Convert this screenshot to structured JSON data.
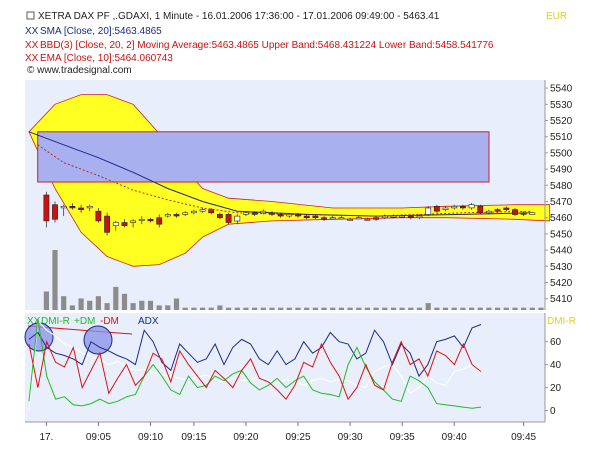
{
  "header": {
    "line1": "XETRA DAX PF      ,.GDAXI, 1 Minute - 16.01.2006 17:36:00 - 17.01.2006 09:49:00 - 5463.41",
    "line2": "SMA [Close, 20]:5463.4865",
    "line3": "BBD(3) [Close, 20, 2] Moving Average:5463.4865 Upper Band:5468.431224 Lower Band:5458.541776",
    "line4": "EMA [Close, 10]:5464.060743",
    "watermark": "© www.tradesignal.com",
    "currency": "EUR",
    "lower_title_dmi": "DMI-R",
    "lower_title_plusdm": "+DM",
    "lower_title_minusdm": "-DM",
    "lower_title_adx": "ADX",
    "lower_right_label": "DMI-R"
  },
  "colors": {
    "panel_bg": "#e8eefc",
    "sma": "#1a2a8a",
    "ema": "#b81818",
    "band_fill": "#ffff22",
    "band_stroke": "#cc2222",
    "box_fill": "#a8b0f0",
    "box_stroke": "#cc2222",
    "up_candle": "#ffffff",
    "down_candle": "#cc1111",
    "volume": "#8c8c8c",
    "dmi_green": "#22bb22",
    "dmi_red": "#dd1111",
    "adx_blue": "#1a2a8a",
    "dmi_white": "#ffffff"
  },
  "chart_data": [
    {
      "type": "candlestick",
      "title": "XETRA DAX PF ,.GDAXI, 1 Minute",
      "ylim": [
        5403,
        5545
      ],
      "y_ticks": [
        5410,
        5420,
        5430,
        5440,
        5450,
        5460,
        5470,
        5480,
        5490,
        5500,
        5510,
        5520,
        5530,
        5540
      ],
      "x_ticks": [
        "17.",
        "09:05",
        "09:10",
        "09:15",
        "09:20",
        "09:25",
        "09:30",
        "09:35",
        "09:40",
        "09:45"
      ],
      "x_tick_index": [
        2,
        8,
        14,
        19,
        25,
        31,
        37,
        43,
        49,
        57
      ],
      "n_bars": 60,
      "candles": [
        {
          "i": 2,
          "o": 5474,
          "h": 5476,
          "l": 5454,
          "c": 5458
        },
        {
          "i": 3,
          "o": 5468,
          "h": 5470,
          "l": 5457,
          "c": 5459
        },
        {
          "i": 4,
          "o": 5466,
          "h": 5468,
          "l": 5461,
          "c": 5467
        },
        {
          "i": 5,
          "o": 5467,
          "h": 5469,
          "l": 5465,
          "c": 5466
        },
        {
          "i": 6,
          "o": 5466,
          "h": 5468,
          "l": 5463,
          "c": 5465
        },
        {
          "i": 7,
          "o": 5466,
          "h": 5468,
          "l": 5464,
          "c": 5467
        },
        {
          "i": 8,
          "o": 5464,
          "h": 5466,
          "l": 5457,
          "c": 5458
        },
        {
          "i": 9,
          "o": 5461,
          "h": 5463,
          "l": 5449,
          "c": 5451
        },
        {
          "i": 10,
          "o": 5455,
          "h": 5458,
          "l": 5452,
          "c": 5457
        },
        {
          "i": 11,
          "o": 5457,
          "h": 5459,
          "l": 5454,
          "c": 5455
        },
        {
          "i": 12,
          "o": 5457,
          "h": 5459,
          "l": 5454,
          "c": 5458
        },
        {
          "i": 13,
          "o": 5459,
          "h": 5461,
          "l": 5456,
          "c": 5459
        },
        {
          "i": 14,
          "o": 5459,
          "h": 5460,
          "l": 5457,
          "c": 5458
        },
        {
          "i": 15,
          "o": 5460,
          "h": 5462,
          "l": 5454,
          "c": 5456
        },
        {
          "i": 16,
          "o": 5461,
          "h": 5463,
          "l": 5460,
          "c": 5462
        },
        {
          "i": 17,
          "o": 5462,
          "h": 5463,
          "l": 5460,
          "c": 5461
        },
        {
          "i": 18,
          "o": 5462,
          "h": 5464,
          "l": 5461,
          "c": 5463
        },
        {
          "i": 19,
          "o": 5463,
          "h": 5465,
          "l": 5462,
          "c": 5464
        },
        {
          "i": 20,
          "o": 5464,
          "h": 5466,
          "l": 5463,
          "c": 5465
        },
        {
          "i": 21,
          "o": 5465,
          "h": 5466,
          "l": 5462,
          "c": 5463
        },
        {
          "i": 22,
          "o": 5462,
          "h": 5463,
          "l": 5459,
          "c": 5460
        },
        {
          "i": 23,
          "o": 5462,
          "h": 5463,
          "l": 5456,
          "c": 5457
        },
        {
          "i": 24,
          "o": 5458,
          "h": 5462,
          "l": 5456,
          "c": 5461
        },
        {
          "i": 25,
          "o": 5462,
          "h": 5464,
          "l": 5461,
          "c": 5463
        },
        {
          "i": 26,
          "o": 5463,
          "h": 5464,
          "l": 5461,
          "c": 5462
        },
        {
          "i": 27,
          "o": 5463,
          "h": 5465,
          "l": 5462,
          "c": 5464
        },
        {
          "i": 28,
          "o": 5463,
          "h": 5464,
          "l": 5461,
          "c": 5462
        },
        {
          "i": 29,
          "o": 5462,
          "h": 5463,
          "l": 5460,
          "c": 5461
        },
        {
          "i": 30,
          "o": 5461,
          "h": 5463,
          "l": 5460,
          "c": 5462
        },
        {
          "i": 31,
          "o": 5462,
          "h": 5463,
          "l": 5460,
          "c": 5461
        },
        {
          "i": 32,
          "o": 5461,
          "h": 5462,
          "l": 5459,
          "c": 5460
        },
        {
          "i": 33,
          "o": 5461,
          "h": 5462,
          "l": 5459,
          "c": 5460
        },
        {
          "i": 34,
          "o": 5460,
          "h": 5461,
          "l": 5458,
          "c": 5459
        },
        {
          "i": 35,
          "o": 5460,
          "h": 5461,
          "l": 5459,
          "c": 5460
        },
        {
          "i": 36,
          "o": 5460,
          "h": 5461,
          "l": 5459,
          "c": 5460
        },
        {
          "i": 37,
          "o": 5459,
          "h": 5460,
          "l": 5458,
          "c": 5459
        },
        {
          "i": 38,
          "o": 5460,
          "h": 5461,
          "l": 5459,
          "c": 5460
        },
        {
          "i": 39,
          "o": 5459,
          "h": 5460,
          "l": 5458,
          "c": 5459
        },
        {
          "i": 40,
          "o": 5460,
          "h": 5461,
          "l": 5458,
          "c": 5459
        },
        {
          "i": 41,
          "o": 5460,
          "h": 5462,
          "l": 5459,
          "c": 5461
        },
        {
          "i": 42,
          "o": 5461,
          "h": 5462,
          "l": 5460,
          "c": 5461
        },
        {
          "i": 43,
          "o": 5461,
          "h": 5462,
          "l": 5460,
          "c": 5461
        },
        {
          "i": 44,
          "o": 5461,
          "h": 5462,
          "l": 5459,
          "c": 5460
        },
        {
          "i": 45,
          "o": 5460,
          "h": 5462,
          "l": 5459,
          "c": 5461
        },
        {
          "i": 46,
          "o": 5462,
          "h": 5467,
          "l": 5461,
          "c": 5466
        },
        {
          "i": 47,
          "o": 5467,
          "h": 5468,
          "l": 5463,
          "c": 5464
        },
        {
          "i": 48,
          "o": 5465,
          "h": 5467,
          "l": 5464,
          "c": 5466
        },
        {
          "i": 49,
          "o": 5466,
          "h": 5468,
          "l": 5465,
          "c": 5467
        },
        {
          "i": 50,
          "o": 5467,
          "h": 5468,
          "l": 5465,
          "c": 5466
        },
        {
          "i": 51,
          "o": 5466,
          "h": 5469,
          "l": 5465,
          "c": 5468
        },
        {
          "i": 52,
          "o": 5467,
          "h": 5468,
          "l": 5462,
          "c": 5463
        },
        {
          "i": 53,
          "o": 5463,
          "h": 5465,
          "l": 5462,
          "c": 5464
        },
        {
          "i": 54,
          "o": 5465,
          "h": 5466,
          "l": 5463,
          "c": 5464
        },
        {
          "i": 55,
          "o": 5466,
          "h": 5467,
          "l": 5464,
          "c": 5465
        },
        {
          "i": 56,
          "o": 5465,
          "h": 5466,
          "l": 5461,
          "c": 5462
        },
        {
          "i": 57,
          "o": 5463,
          "h": 5464,
          "l": 5461,
          "c": 5462
        },
        {
          "i": 58,
          "o": 5462,
          "h": 5463,
          "l": 5462,
          "c": 5463
        }
      ],
      "volume": [
        0,
        0,
        8,
        26,
        6,
        2,
        5,
        4,
        6,
        3,
        10,
        7,
        3,
        4,
        4,
        2,
        2,
        5,
        1,
        1,
        1,
        1,
        2,
        1,
        1,
        1,
        1,
        1,
        1,
        1,
        1,
        1,
        1,
        1,
        1,
        1,
        1,
        1,
        1,
        1,
        1,
        1,
        1,
        1,
        1,
        1,
        3,
        1,
        1,
        1,
        1,
        1,
        1,
        1,
        1,
        1,
        1,
        1,
        1,
        1
      ],
      "sma": [
        [
          0,
          5513
        ],
        [
          4,
          5505
        ],
        [
          8,
          5497
        ],
        [
          12,
          5488
        ],
        [
          16,
          5478
        ],
        [
          20,
          5470
        ],
        [
          24,
          5464
        ],
        [
          28,
          5463
        ],
        [
          32,
          5462
        ],
        [
          40,
          5461
        ],
        [
          50,
          5462
        ],
        [
          58,
          5463
        ]
      ],
      "ema": [
        [
          1,
          5505
        ],
        [
          4,
          5494
        ],
        [
          8,
          5486
        ],
        [
          12,
          5477
        ],
        [
          16,
          5471
        ],
        [
          20,
          5466
        ],
        [
          24,
          5463
        ],
        [
          30,
          5462
        ],
        [
          40,
          5461
        ],
        [
          50,
          5463
        ],
        [
          58,
          5464
        ]
      ],
      "upper_band": [
        [
          0,
          5513
        ],
        [
          3,
          5530
        ],
        [
          6,
          5536
        ],
        [
          9,
          5536
        ],
        [
          12,
          5530
        ],
        [
          15,
          5512
        ],
        [
          18,
          5490
        ],
        [
          20,
          5478
        ],
        [
          23,
          5472
        ],
        [
          28,
          5470
        ],
        [
          35,
          5466
        ],
        [
          43,
          5466
        ],
        [
          48,
          5467
        ],
        [
          56,
          5468
        ],
        [
          60,
          5468
        ]
      ],
      "lower_band": [
        [
          0,
          5513
        ],
        [
          3,
          5478
        ],
        [
          6,
          5451
        ],
        [
          9,
          5436
        ],
        [
          12,
          5430
        ],
        [
          15,
          5431
        ],
        [
          18,
          5438
        ],
        [
          20,
          5448
        ],
        [
          23,
          5456
        ],
        [
          28,
          5458
        ],
        [
          35,
          5459
        ],
        [
          43,
          5460
        ],
        [
          48,
          5460
        ],
        [
          56,
          5459
        ],
        [
          60,
          5458
        ]
      ],
      "box": {
        "x0": 1,
        "x1": 53,
        "y0": 5482,
        "y1": 5513
      }
    },
    {
      "type": "line",
      "title": "DMI-R +DM -DM ADX",
      "ylim": [
        -10,
        85
      ],
      "y_ticks": [
        0,
        20,
        40,
        60
      ],
      "series": [
        {
          "name": "DMI-R",
          "values": [
            0,
            78,
            70,
            65,
            58,
            55,
            50,
            47,
            44,
            40,
            43,
            38,
            35,
            36,
            33,
            31,
            30,
            28,
            27,
            29,
            31,
            27,
            25,
            28,
            26,
            27,
            30,
            26,
            24,
            27,
            25,
            22,
            26,
            28,
            25,
            27,
            26,
            22,
            20,
            34,
            38,
            40,
            30,
            15,
            20,
            30,
            24,
            22,
            34,
            36,
            40,
            35
          ]
        },
        {
          "name": "+DM",
          "values": [
            8,
            80,
            30,
            10,
            12,
            5,
            4,
            6,
            10,
            6,
            8,
            12,
            14,
            30,
            40,
            30,
            18,
            14,
            30,
            20,
            22,
            30,
            26,
            32,
            35,
            24,
            18,
            22,
            28,
            20,
            26,
            30,
            18,
            15,
            14,
            12,
            40,
            55,
            38,
            25,
            18,
            10,
            8,
            30,
            26,
            20,
            6,
            5,
            4,
            3,
            2,
            3
          ]
        },
        {
          "name": "-DM",
          "values": [
            58,
            20,
            60,
            42,
            38,
            55,
            20,
            35,
            50,
            15,
            28,
            40,
            22,
            30,
            50,
            45,
            25,
            52,
            40,
            30,
            20,
            35,
            28,
            20,
            35,
            45,
            28,
            25,
            18,
            10,
            22,
            42,
            38,
            58,
            42,
            30,
            10,
            20,
            40,
            22,
            18,
            42,
            60,
            40,
            45,
            30,
            52,
            48,
            40,
            58,
            40,
            34
          ]
        },
        {
          "name": "ADX",
          "values": [
            62,
            68,
            55,
            50,
            48,
            45,
            40,
            60,
            55,
            52,
            48,
            45,
            40,
            70,
            60,
            42,
            35,
            58,
            50,
            42,
            45,
            58,
            40,
            55,
            62,
            58,
            45,
            40,
            52,
            40,
            45,
            60,
            50,
            55,
            68,
            60,
            58,
            45,
            50,
            70,
            60,
            40,
            58,
            50,
            30,
            40,
            60,
            62,
            65,
            55,
            72,
            75
          ]
        }
      ]
    }
  ]
}
